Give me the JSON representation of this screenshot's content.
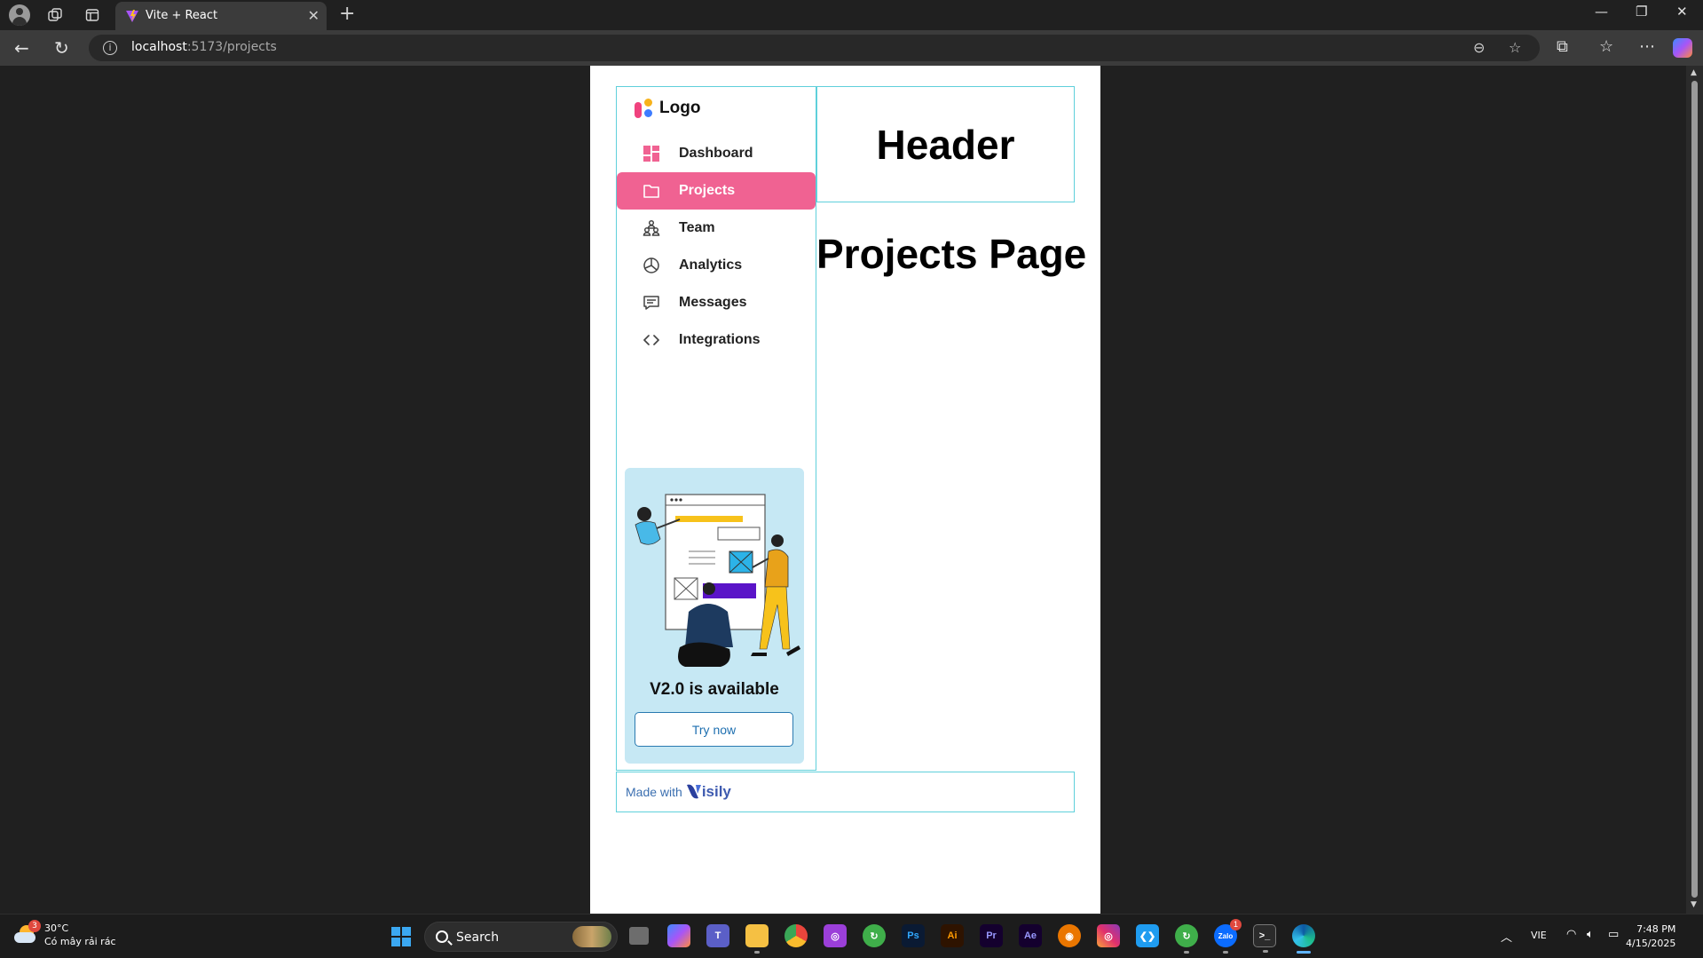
{
  "browser": {
    "tab_title": "Vite + React",
    "url_host": "localhost",
    "url_path": ":5173/projects"
  },
  "app": {
    "logo_text": "Logo",
    "nav": [
      {
        "label": "Dashboard",
        "icon": "dashboard-icon",
        "active": false
      },
      {
        "label": "Projects",
        "icon": "folder-icon",
        "active": true
      },
      {
        "label": "Team",
        "icon": "team-icon",
        "active": false
      },
      {
        "label": "Analytics",
        "icon": "pie-chart-icon",
        "active": false
      },
      {
        "label": "Messages",
        "icon": "message-icon",
        "active": false
      },
      {
        "label": "Integrations",
        "icon": "code-icon",
        "active": false
      }
    ],
    "promo": {
      "title": "V2.0 is available",
      "button": "Try now"
    },
    "header": "Header",
    "page_title": "Projects Page",
    "footer": {
      "made_with": "Made with",
      "brand": "isily"
    },
    "colors": {
      "accent": "#f06292",
      "border": "#5fd0db",
      "promo_bg": "#c6e8f4"
    }
  },
  "taskbar": {
    "weather_temp": "30°C",
    "weather_desc": "Có mây rải rác",
    "weather_badge": "3",
    "search_label": "Search",
    "apps": [
      {
        "name": "task-view-icon",
        "text": ""
      },
      {
        "name": "copilot-icon",
        "text": ""
      },
      {
        "name": "teams-icon",
        "text": ""
      },
      {
        "name": "file-explorer-icon",
        "text": ""
      },
      {
        "name": "chrome-icon",
        "text": ""
      },
      {
        "name": "app-icon",
        "text": ""
      },
      {
        "name": "app-green-icon",
        "text": ""
      },
      {
        "name": "photoshop-icon",
        "text": "Ps"
      },
      {
        "name": "illustrator-icon",
        "text": "Ai"
      },
      {
        "name": "premiere-icon",
        "text": "Pr"
      },
      {
        "name": "after-effects-icon",
        "text": "Ae"
      },
      {
        "name": "blender-icon",
        "text": ""
      },
      {
        "name": "instagram-icon",
        "text": ""
      },
      {
        "name": "vscode-icon",
        "text": ""
      },
      {
        "name": "app-green-2-icon",
        "text": ""
      },
      {
        "name": "zalo-icon",
        "text": "Zalo"
      },
      {
        "name": "terminal-icon",
        "text": ""
      },
      {
        "name": "edge-icon",
        "text": ""
      }
    ],
    "zalo_badge": "1",
    "language": "VIE",
    "time": "7:48 PM",
    "date": "4/15/2025"
  }
}
